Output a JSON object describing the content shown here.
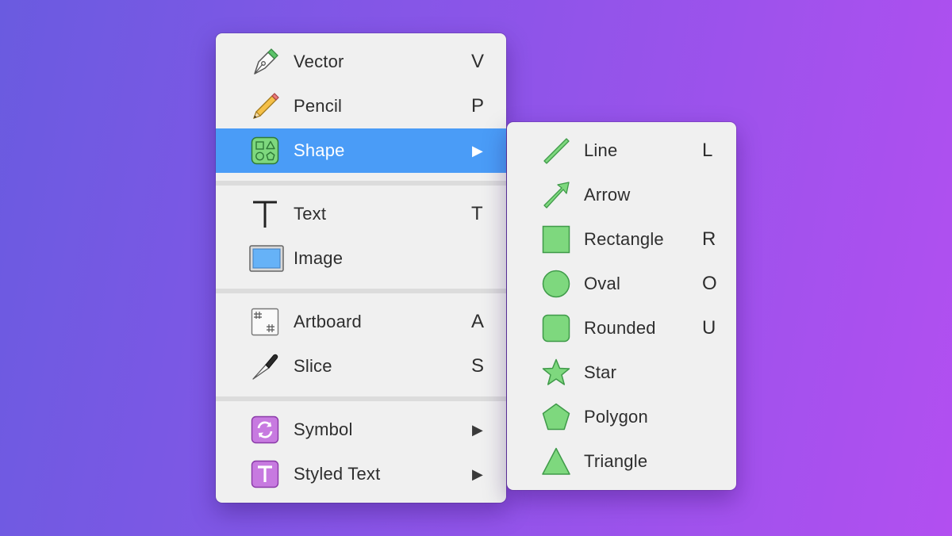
{
  "main_menu": {
    "items": [
      {
        "label": "Vector",
        "shortcut": "V",
        "icon": "pen-nib-icon"
      },
      {
        "label": "Pencil",
        "shortcut": "P",
        "icon": "pencil-icon"
      },
      {
        "label": "Shape",
        "submenu_arrow": "▶",
        "icon": "shapes-icon",
        "selected": true
      },
      {
        "label": "Text",
        "shortcut": "T",
        "icon": "text-icon"
      },
      {
        "label": "Image",
        "icon": "image-icon"
      },
      {
        "label": "Artboard",
        "shortcut": "A",
        "icon": "artboard-icon"
      },
      {
        "label": "Slice",
        "shortcut": "S",
        "icon": "knife-icon"
      },
      {
        "label": "Symbol",
        "submenu_arrow": "▶",
        "icon": "symbol-icon"
      },
      {
        "label": "Styled Text",
        "submenu_arrow": "▶",
        "icon": "styled-text-icon"
      }
    ]
  },
  "shape_submenu": {
    "items": [
      {
        "label": "Line",
        "shortcut": "L",
        "icon": "line-icon"
      },
      {
        "label": "Arrow",
        "icon": "arrow-icon"
      },
      {
        "label": "Rectangle",
        "shortcut": "R",
        "icon": "rectangle-icon"
      },
      {
        "label": "Oval",
        "shortcut": "O",
        "icon": "oval-icon"
      },
      {
        "label": "Rounded",
        "shortcut": "U",
        "icon": "rounded-rectangle-icon"
      },
      {
        "label": "Star",
        "icon": "star-icon"
      },
      {
        "label": "Polygon",
        "icon": "polygon-icon"
      },
      {
        "label": "Triangle",
        "icon": "triangle-icon"
      }
    ]
  },
  "colors": {
    "selection": "#4a9cf7",
    "shape_green": "#7ed87e",
    "shape_green_stroke": "#3f9a49",
    "symbol_purple": "#c77ae0"
  }
}
